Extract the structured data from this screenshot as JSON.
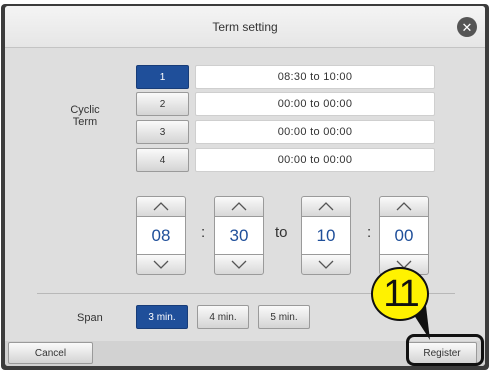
{
  "dialog": {
    "title": "Term setting",
    "close_icon": "close-icon"
  },
  "cyclic_term": {
    "label_line1": "Cyclic",
    "label_line2": "Term",
    "rows": [
      {
        "index": "1",
        "value": "08:30 to 10:00",
        "active": true
      },
      {
        "index": "2",
        "value": "00:00 to 00:00",
        "active": false
      },
      {
        "index": "3",
        "value": "00:00 to 00:00",
        "active": false
      },
      {
        "index": "4",
        "value": "00:00 to 00:00",
        "active": false
      }
    ]
  },
  "time_editor": {
    "start_hour": "08",
    "start_minute": "30",
    "end_hour": "10",
    "end_minute": "00",
    "colon": ":",
    "to_label": "to",
    "up_icon": "chevron-up-icon",
    "down_icon": "chevron-down-icon"
  },
  "span": {
    "label": "Span",
    "options": [
      {
        "label": "3 min.",
        "selected": true
      },
      {
        "label": "4 min.",
        "selected": false
      },
      {
        "label": "5 min.",
        "selected": false
      }
    ]
  },
  "footer": {
    "cancel_label": "Cancel",
    "register_label": "Register"
  },
  "annotation": {
    "step_number": "11",
    "color": "#fff200"
  },
  "colors": {
    "accent": "#1f4f9a",
    "dialog_bg": "#dedede"
  }
}
